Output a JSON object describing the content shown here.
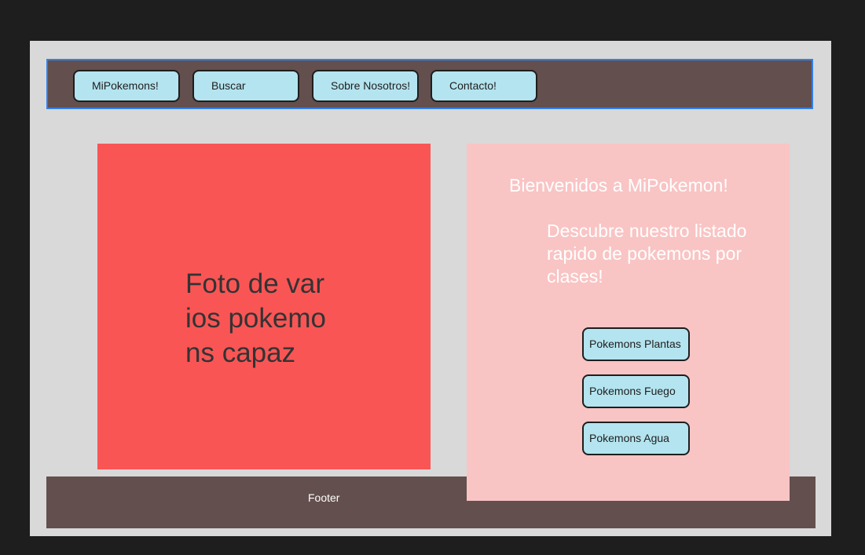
{
  "nav": {
    "items": [
      {
        "label": "MiPokemons!"
      },
      {
        "label": "Buscar"
      },
      {
        "label": "Sobre Nosotros!"
      },
      {
        "label": "Contacto!"
      }
    ]
  },
  "photo": {
    "placeholder_text": "Foto de varios pokemons capaz"
  },
  "panel": {
    "welcome": "Bienvenidos a MiPokemon!",
    "description": "Descubre nuestro listado rapido de pokemons por clases!",
    "buttons": [
      {
        "label": "Pokemons Plantas"
      },
      {
        "label": "Pokemons Fuego"
      },
      {
        "label": "Pokemons Agua"
      }
    ]
  },
  "footer": {
    "label": "Footer"
  },
  "colors": {
    "background": "#1e1e1e",
    "canvas": "#d9d9d9",
    "bar": "#634f4d",
    "button": "#b4e4ef",
    "photo": "#f95555",
    "panel": "#f9c4c4",
    "nav_border": "#2f80ed"
  }
}
